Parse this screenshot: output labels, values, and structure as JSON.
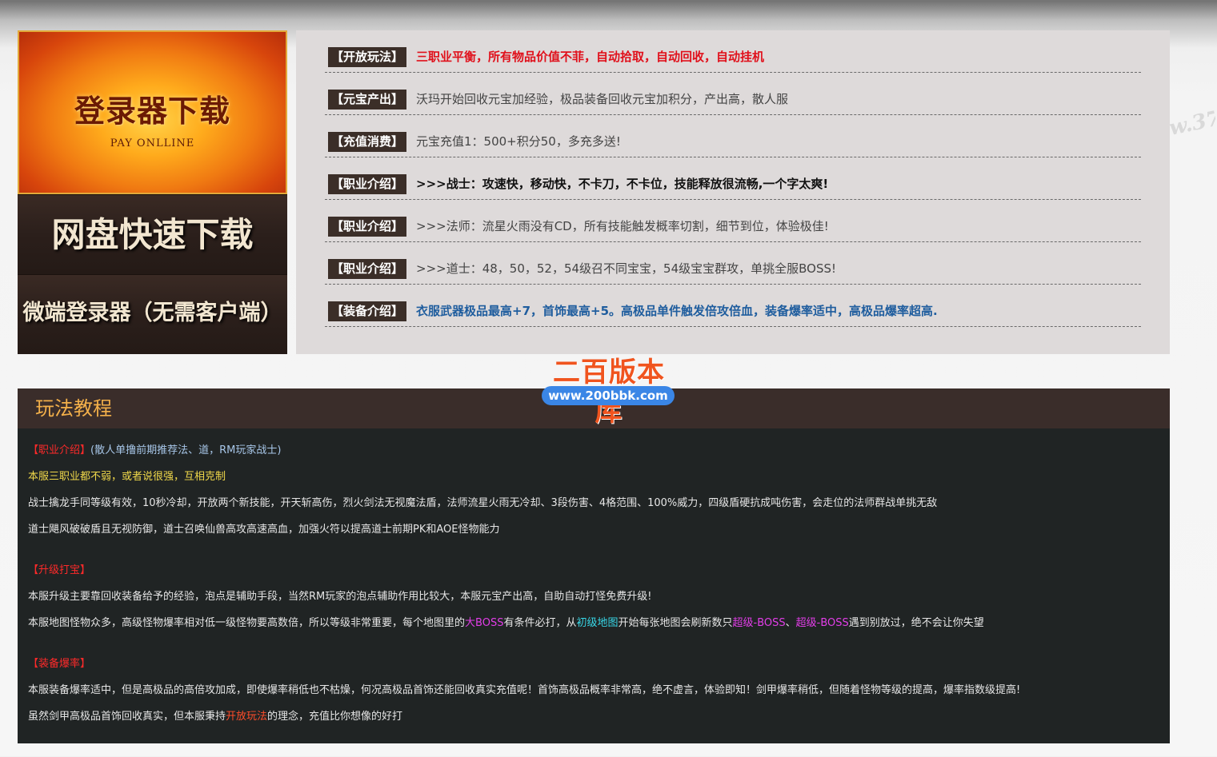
{
  "left_panel": {
    "top_button": {
      "title": "登录器下载",
      "subtitle": "PAY ONLLINE"
    },
    "mid_button": {
      "title": "网盘快速下载"
    },
    "bottom_button": {
      "title": "微端登录器（无需客户端）"
    }
  },
  "side_watermark": "w.37",
  "info_rows": [
    {
      "tag": "【开放玩法】",
      "text": "三职业平衡，所有物品价值不菲，自动拾取，自动回收，自动挂机"
    },
    {
      "tag": "【元宝产出】",
      "text": "沃玛开始回收元宝加经验，极品装备回收元宝加积分，产出高，散人服"
    },
    {
      "tag": "【充值消费】",
      "text": "元宝充值1：500+积分50，多充多送!"
    },
    {
      "tag": "【职业介绍】",
      "text": ">>>战士：攻速快，移动快，不卡刀，不卡位，技能释放很流畅,一个字太爽!"
    },
    {
      "tag": "【职业介绍】",
      "text": ">>>法师：流星火雨没有CD，所有技能触发概率切割，细节到位，体验极佳!"
    },
    {
      "tag": "【职业介绍】",
      "text": ">>>道士：48，50，52，54级召不同宝宝，54级宝宝群攻，单挑全服BOSS!"
    },
    {
      "tag": "【装备介绍】",
      "text": "衣服武器极品最高+7，首饰最高+5。高极品单件触发倍攻倍血，装备爆率适中，高极品爆率超高."
    }
  ],
  "brand": {
    "name": "二百版本库",
    "url": "www.200bbk.com"
  },
  "tutorial": {
    "title": "玩法教程",
    "l1_tag": "【职业介绍】",
    "l1_text": "(散人单撸前期推荐法、道，RM玩家战士)",
    "l2": "本服三职业都不弱，或者说很强，互相克制",
    "l3": "战士擒龙手同等级有效，10秒冷却，开放两个新技能，开天斩高伤，烈火剑法无视魔法盾，法师流星火雨无冷却、3段伤害、4格范围、100%威力，四级盾硬抗成吨伤害，会走位的法师群战单挑无敌",
    "l4": "道士飓风破破盾且无视防御，道士召唤仙兽高攻高速高血，加强火符以提高道士前期PK和AOE怪物能力",
    "l5_tag": "【升级打宝】",
    "l6": "本服升级主要靠回收装备给予的经验，泡点是辅助手段，当然RM玩家的泡点辅助作用比较大，本服元宝产出高，自助自动打怪免费升级!",
    "l7_a": "本服地图怪物众多，高级怪物爆率相对低一级怪物要高数倍，所以等级非常重要，每个地图里的",
    "l7_b": "大BOSS",
    "l7_c": "有条件必打，从",
    "l7_d": "初级地图",
    "l7_e": "开始每张地图会刷新数只",
    "l7_f": "超级-BOSS",
    "l7_g": "、",
    "l7_h": "超级-BOSS",
    "l7_i": "遇到别放过，绝不会让你失望",
    "l8_tag": "【装备爆率】",
    "l9": "本服装备爆率适中，但是高极品的高倍攻加成，即使爆率稍低也不枯燥，何况高极品首饰还能回收真实充值呢！首饰高极品概率非常高，绝不虚言，体验即知！剑甲爆率稍低，但随着怪物等级的提高，爆率指数级提高!",
    "l10_a": "虽然剑甲高极品首饰回收真实，但本服秉持",
    "l10_b": "开放玩法",
    "l10_c": "的理念，充值比你想像的好打"
  },
  "colors": {
    "tag_bg": "#3b2e28",
    "info_bg": "#dedada",
    "red_text": "#e0101b",
    "blue_text": "#1f5d9e",
    "tutorial_title": "#f3b04a",
    "tutorial_bg": "#202424",
    "brand_orange": "#f0541e",
    "brand_blue": "#3a86e6"
  }
}
